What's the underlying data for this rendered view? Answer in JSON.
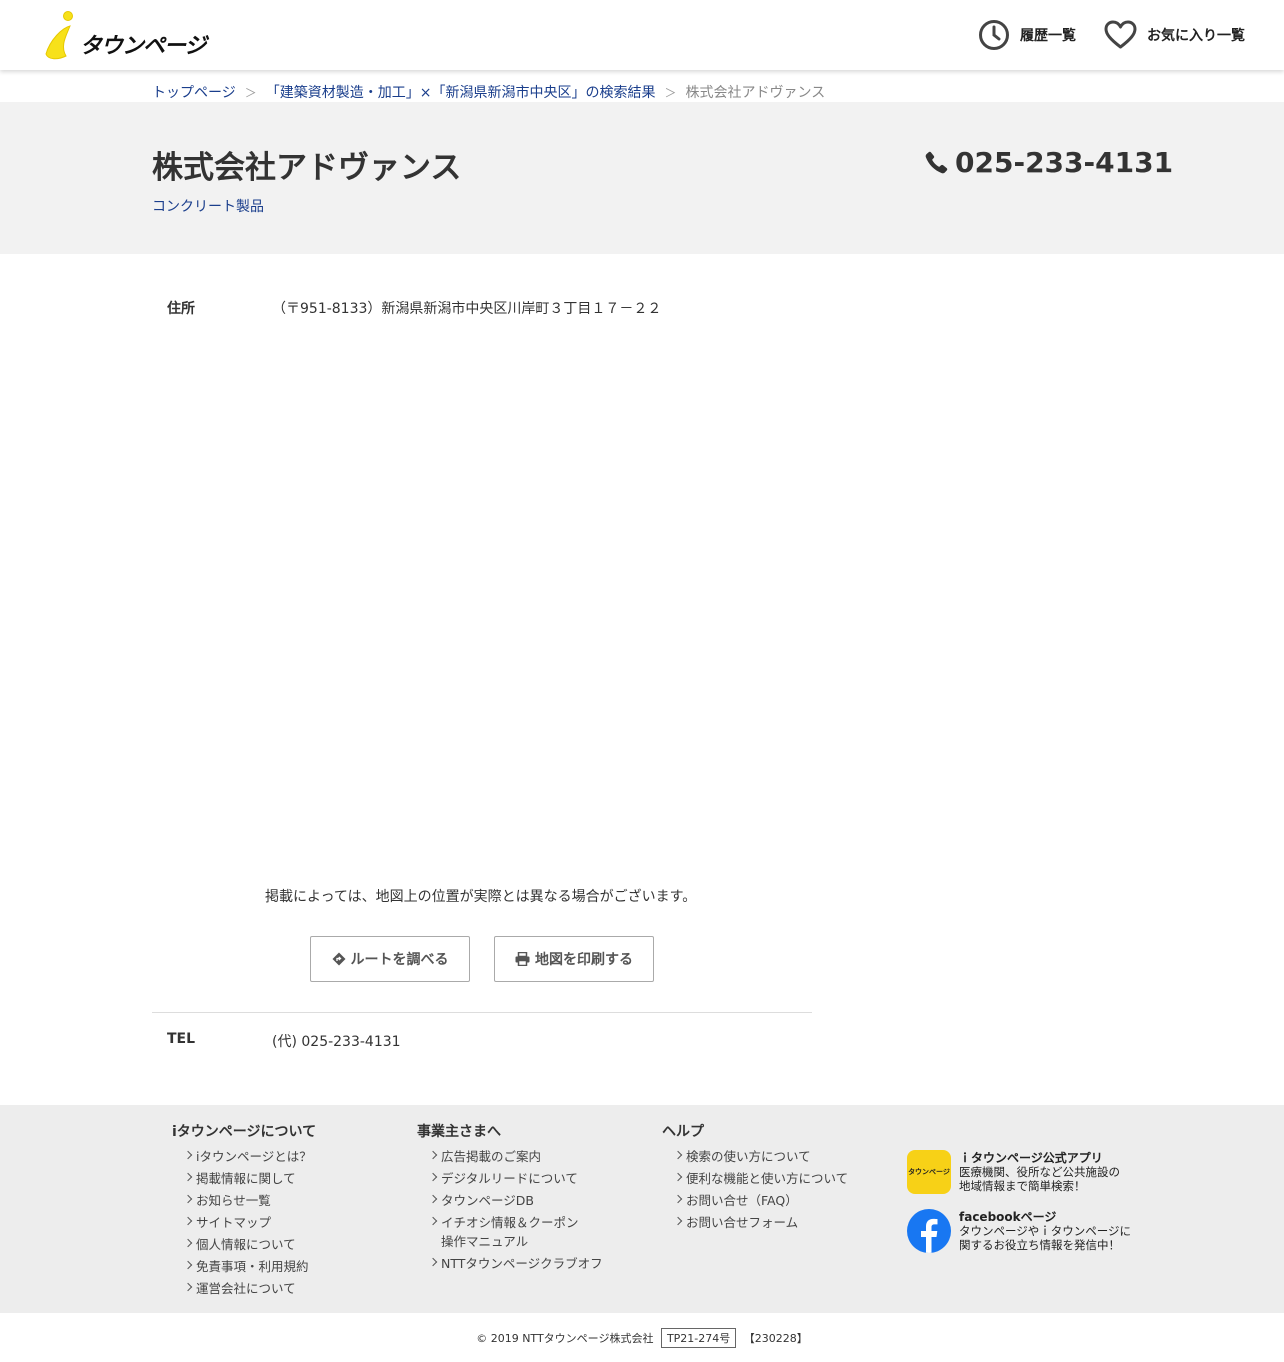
{
  "header": {
    "logo_text": "タウンページ",
    "history_label": "履歴一覧",
    "favorites_label": "お気に入り一覧",
    "logo_color": "#f7e11a"
  },
  "breadcrumb": {
    "home": "トップページ",
    "search": "「建築資材製造・加工」×「新潟県新潟市中央区」の検索結果",
    "current": "株式会社アドヴァンス",
    "separator": "＞"
  },
  "company": {
    "name": "株式会社アドヴァンス",
    "category": "コンクリート製品",
    "phone": "025-233-4131"
  },
  "details": {
    "address_label": "住所",
    "address_value": "（〒951-8133）新潟県新潟市中央区川岸町３丁目１７－２２",
    "map_note": "掲載によっては、地図上の位置が実際とは異なる場合がございます。",
    "route_button": "ルートを調べる",
    "print_button": "地図を印刷する",
    "tel_label": "TEL",
    "tel_value": "(代) 025-233-4131"
  },
  "footer": {
    "col1": {
      "title": "iタウンページについて",
      "items": [
        "iタウンページとは？",
        "掲載情報に関して",
        "お知らせ一覧",
        "サイトマップ",
        "個人情報について",
        "免責事項・利用規約",
        "運営会社について"
      ]
    },
    "col2": {
      "title": "事業主さまへ",
      "items": [
        "広告掲載のご案内",
        "デジタルリードについて",
        "タウンページDB",
        "イチオシ情報＆クーポン",
        "操作マニュアル",
        "NTTタウンページクラブオフ"
      ]
    },
    "col3": {
      "title": "ヘルプ",
      "items": [
        "検索の使い方について",
        "便利な機能と使い方について",
        "お問い合せ（FAQ）",
        "お問い合せフォーム"
      ]
    },
    "app_promo": {
      "title": "ｉタウンページ公式アプリ",
      "line1": "医療機関、役所など公共施設の",
      "line2": "地域情報まで簡単検索！",
      "icon_text": "タウンページ"
    },
    "fb_promo": {
      "title": "facebookページ",
      "line1": "タウンページやｉタウンページに",
      "line2": "関するお役立ち情報を発信中！"
    },
    "copyright": "© 2019 NTTタウンページ株式会社",
    "code": "TP21-274号",
    "version": "【230228】"
  }
}
